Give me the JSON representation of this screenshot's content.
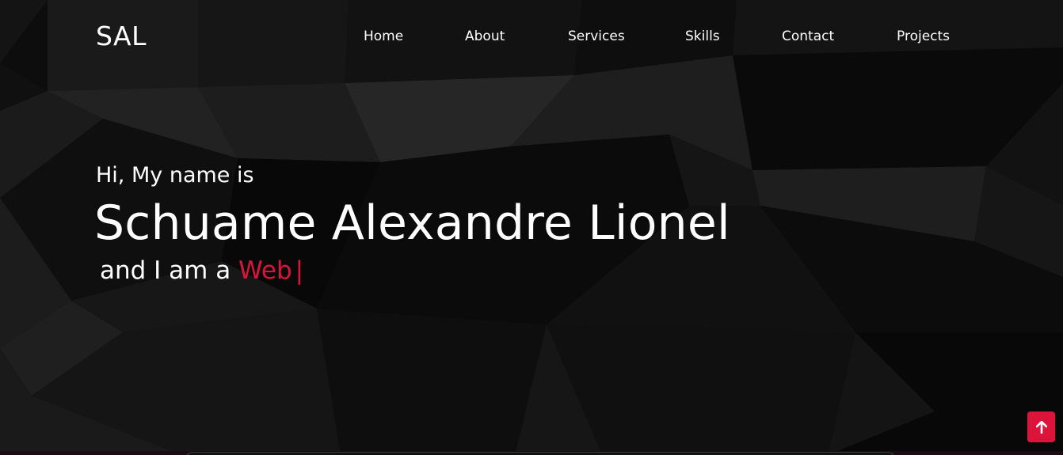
{
  "navbar": {
    "logo": "SAL",
    "menu": [
      {
        "label": "Home"
      },
      {
        "label": "About"
      },
      {
        "label": "Services"
      },
      {
        "label": "Skills"
      },
      {
        "label": "Contact"
      },
      {
        "label": "Projects"
      }
    ]
  },
  "home": {
    "greeting": "Hi, My name is",
    "name": "Schuame Alexandre Lionel",
    "role_prefix": "and I am a",
    "role_typed": "Web",
    "cursor": "|"
  },
  "scroll_up": {
    "icon": "arrow-up-icon"
  },
  "colors": {
    "accent": "#dc143c",
    "background": "#0c0c0d",
    "text": "#ffffff"
  }
}
